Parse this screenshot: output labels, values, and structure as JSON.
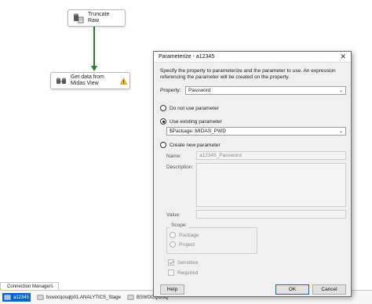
{
  "canvas": {
    "tasks": [
      {
        "label": "Truncate Raw"
      },
      {
        "label": "Get data from Midas View"
      }
    ]
  },
  "connection_managers": {
    "tab_label": "Connection Managers",
    "items": [
      {
        "label": "a12345",
        "selected": true
      },
      {
        "label": "bswocqosqlp01.ANALYTICS_Stage",
        "selected": false
      },
      {
        "label": "BSWOCQOSQ",
        "selected": false
      }
    ]
  },
  "dialog": {
    "title": "Parameterize - a12345",
    "close_glyph": "✕",
    "description": "Specify the property to parameterize and the parameter to use. An expression referencing the parameter will be created on the property.",
    "property_label": "Property:",
    "property_value": "Password",
    "options": {
      "no_param": "Do not use parameter",
      "use_existing": "Use existing parameter",
      "create_new": "Create new parameter"
    },
    "existing_param_value": "$Package::MIDAS_PWD",
    "name_label": "Name:",
    "name_value": "a12345_Password",
    "description_label": "Description:",
    "value_label": "Value:",
    "scope_label": "Scope:",
    "scope_package": "Package",
    "scope_project": "Project",
    "sensitive_label": "Sensitive",
    "required_label": "Required",
    "help_button": "Help",
    "ok_button": "OK",
    "cancel_button": "Cancel"
  },
  "colors": {
    "precedence_green": "#2e7d32",
    "selection_blue": "#0a64c8",
    "warning_yellow": "#f5c400"
  },
  "icons": {
    "truncate": "sql-task-icon",
    "dataflow": "data-flow-task-icon",
    "warning": "warning-icon",
    "connection": "connection-icon"
  }
}
